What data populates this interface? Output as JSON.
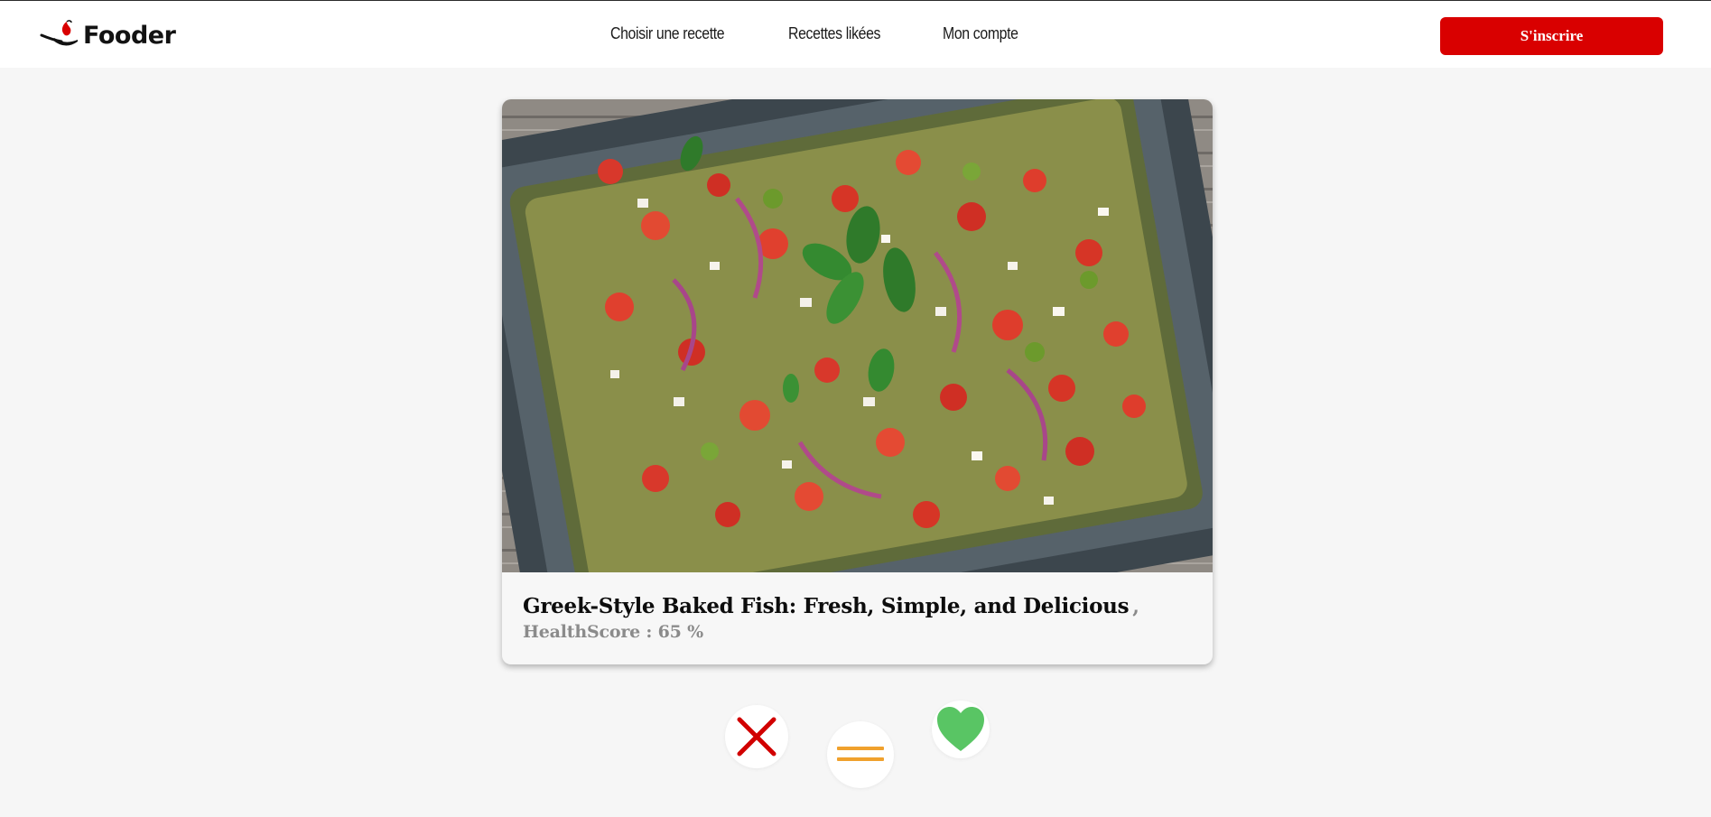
{
  "header": {
    "logo_text": "Fooder",
    "nav": [
      {
        "label": "Choisir une recette"
      },
      {
        "label": "Recettes likées"
      },
      {
        "label": "Mon compte"
      }
    ],
    "signup_label": "S'inscrire"
  },
  "card": {
    "image_alt": "Greek-Style Baked Fish: Fresh, Simple, and Delicious",
    "title": "Greek-Style Baked Fish: Fresh, Simple, and Delicious",
    "separator": ",",
    "health_score_text": "HealthScore : 65 %"
  },
  "actions": {
    "dislike_icon": "close-icon",
    "neutral_icon": "equals-icon",
    "like_icon": "heart-icon"
  },
  "colors": {
    "brand_red": "#d90000",
    "dislike_red": "#d10000",
    "neutral_orange": "#f0a12d",
    "like_green": "#59c564"
  }
}
